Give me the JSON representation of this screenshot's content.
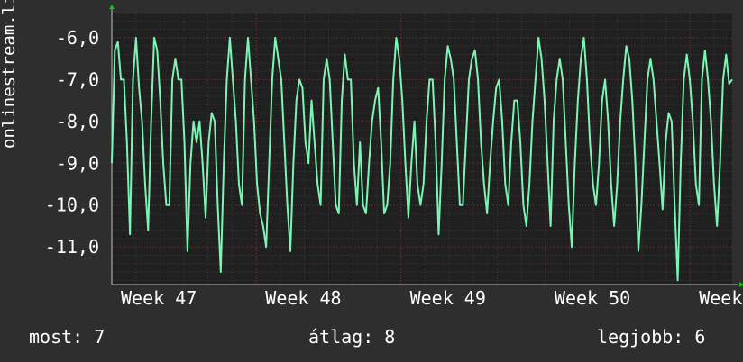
{
  "chart_data": {
    "type": "line",
    "ylabel": "onlinestream.live",
    "yticks": [
      -6.0,
      -7.0,
      -8.0,
      -9.0,
      -10.0,
      -11.0
    ],
    "ytick_labels": [
      "-6,0",
      "-7,0",
      "-8,0",
      "-9,0",
      "-10,0",
      "-11,0"
    ],
    "ylim": [
      -11.9,
      -5.4
    ],
    "xlim": [
      0,
      100
    ],
    "xticks": [
      0,
      23.3,
      46.6,
      69.9,
      93.2
    ],
    "xtick_labels": [
      "Week 47",
      "Week 48",
      "Week 49",
      "Week 50",
      "Week"
    ],
    "grid": true,
    "series": [
      {
        "color": "#7cf5b4",
        "values": [
          -9.0,
          -6.3,
          -6.1,
          -7.0,
          -7.0,
          -8.5,
          -10.7,
          -7.0,
          -6.0,
          -7.2,
          -8.0,
          -9.5,
          -10.6,
          -8.0,
          -6.0,
          -6.3,
          -7.5,
          -9.0,
          -10.0,
          -10.0,
          -7.0,
          -6.5,
          -7.0,
          -7.0,
          -8.5,
          -11.1,
          -9.0,
          -8.0,
          -8.5,
          -8.0,
          -9.0,
          -10.3,
          -8.5,
          -7.8,
          -8.0,
          -10.0,
          -11.6,
          -9.0,
          -7.0,
          -6.0,
          -7.0,
          -8.0,
          -9.5,
          -10.0,
          -7.0,
          -6.0,
          -7.0,
          -8.0,
          -9.5,
          -10.2,
          -10.5,
          -11.0,
          -9.0,
          -7.0,
          -6.0,
          -6.5,
          -7.0,
          -8.5,
          -10.0,
          -11.1,
          -9.0,
          -7.5,
          -7.0,
          -7.2,
          -8.5,
          -9.0,
          -7.5,
          -8.5,
          -9.5,
          -10.0,
          -7.0,
          -6.5,
          -7.0,
          -8.5,
          -10.0,
          -10.2,
          -7.5,
          -6.4,
          -7.0,
          -7.0,
          -9.0,
          -10.0,
          -8.5,
          -10.0,
          -10.2,
          -9.0,
          -8.0,
          -7.5,
          -7.2,
          -8.5,
          -10.2,
          -10.0,
          -9.0,
          -7.0,
          -6.0,
          -6.5,
          -7.5,
          -9.0,
          -10.3,
          -9.0,
          -8.0,
          -9.5,
          -10.0,
          -9.5,
          -8.0,
          -7.0,
          -7.0,
          -8.5,
          -10.7,
          -9.0,
          -7.0,
          -6.2,
          -6.5,
          -7.0,
          -8.5,
          -10.0,
          -10.0,
          -8.5,
          -7.0,
          -6.5,
          -6.3,
          -7.0,
          -8.5,
          -9.5,
          -10.2,
          -9.0,
          -8.0,
          -7.2,
          -7.0,
          -8.0,
          -9.5,
          -10.0,
          -8.5,
          -7.5,
          -7.5,
          -8.5,
          -10.0,
          -10.5,
          -9.5,
          -8.0,
          -7.0,
          -6.0,
          -6.5,
          -7.5,
          -9.0,
          -10.5,
          -8.0,
          -7.0,
          -6.5,
          -7.0,
          -8.5,
          -10.0,
          -11.0,
          -9.0,
          -7.5,
          -6.5,
          -6.0,
          -7.0,
          -8.5,
          -9.5,
          -10.0,
          -9.0,
          -7.5,
          -7.0,
          -8.0,
          -9.5,
          -10.5,
          -9.5,
          -8.0,
          -7.0,
          -6.2,
          -6.5,
          -7.5,
          -9.0,
          -11.1,
          -10.0,
          -8.5,
          -7.0,
          -6.5,
          -7.0,
          -8.0,
          -9.0,
          -10.1,
          -8.5,
          -7.8,
          -8.0,
          -10.0,
          -11.8,
          -9.0,
          -7.0,
          -6.4,
          -7.0,
          -8.0,
          -9.5,
          -10.0,
          -7.0,
          -6.3,
          -7.0,
          -8.0,
          -9.5,
          -10.5,
          -9.0,
          -7.0,
          -6.4,
          -7.1,
          -7.0
        ]
      }
    ]
  },
  "footer": {
    "now_label": "most:",
    "now_value": "7",
    "avg_label": "átlag:",
    "avg_value": "8",
    "best_label": "legjobb:",
    "best_value": "6"
  }
}
